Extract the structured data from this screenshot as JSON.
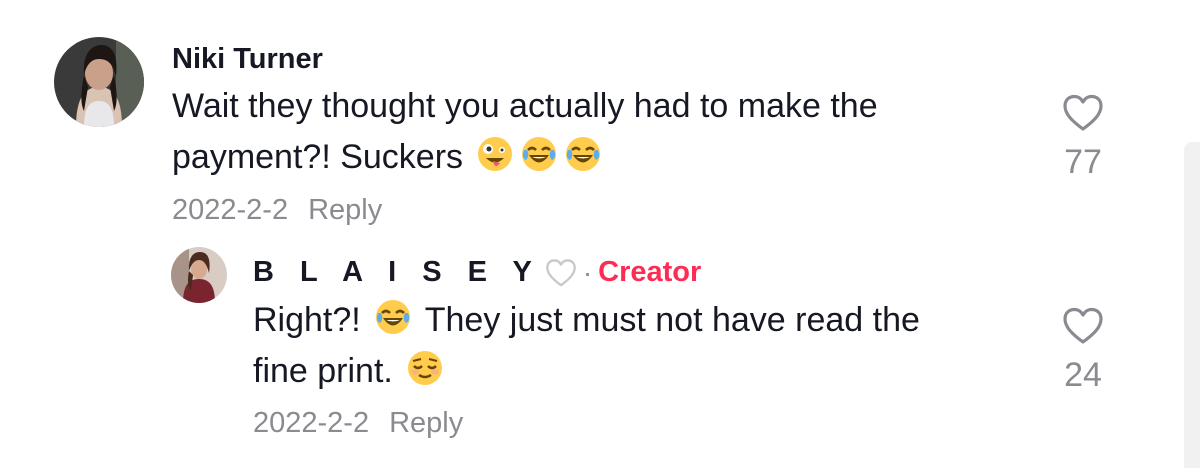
{
  "comments": [
    {
      "username": "Niki Turner",
      "text_line1": "Wait they thought you actually had to make the",
      "text_line2": "payment?! Suckers",
      "emojis": [
        "zany-face-emoji",
        "tears-of-joy-emoji",
        "tears-of-joy-emoji"
      ],
      "date": "2022-2-2",
      "reply_label": "Reply",
      "likes": "77"
    }
  ],
  "reply": {
    "username": "B L A I S E Y",
    "separator": "·",
    "badge": "Creator",
    "text_line1_before": "Right?!",
    "text_line1_after": "They just must not have read the",
    "text_line2": "fine print.",
    "emojis": [
      "tears-of-joy-emoji",
      "relieved-face-emoji"
    ],
    "date": "2022-2-2",
    "reply_label": "Reply",
    "likes": "24"
  },
  "colors": {
    "creator_badge": "#fe2c55",
    "muted_text": "#8a8b91",
    "primary_text": "#161823"
  }
}
